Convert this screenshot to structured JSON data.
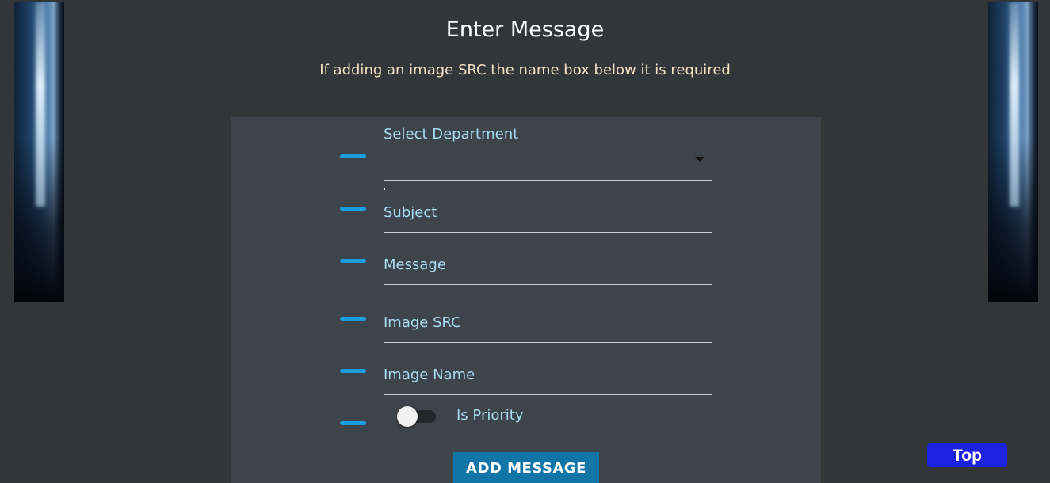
{
  "header": {
    "title": "Enter Message",
    "subtitle": "If adding an image SRC the name box below it is required"
  },
  "form": {
    "fields": [
      {
        "label": "Select Department",
        "type": "select"
      },
      {
        "label": "Subject",
        "type": "text"
      },
      {
        "label": "Message",
        "type": "text"
      },
      {
        "label": "Image SRC",
        "type": "text"
      },
      {
        "label": "Image Name",
        "type": "text"
      }
    ],
    "priority": {
      "label": "Is Priority",
      "checked": false
    },
    "submit_label": "ADD MESSAGE"
  },
  "top_button": {
    "label": "Top"
  },
  "colors": {
    "background": "#333638",
    "card": "#3d444c",
    "label": "#a8dcf0",
    "accent": "#1a9ee0",
    "button": "#1275a8",
    "top_button": "#1b23e0",
    "subtitle": "#f2e2c6"
  }
}
